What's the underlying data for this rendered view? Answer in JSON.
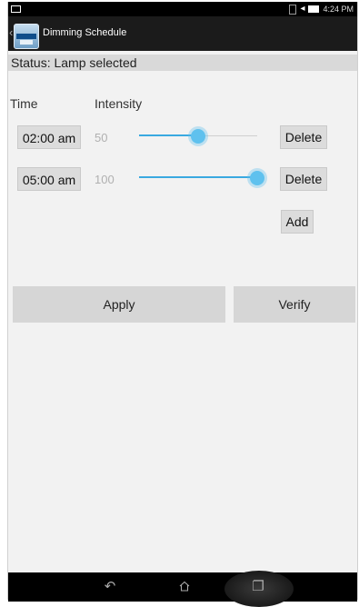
{
  "status_bar": {
    "time": "4:24 PM",
    "icons": [
      "notification-icon",
      "sim-icon",
      "wifi-icon",
      "battery-icon"
    ]
  },
  "action_bar": {
    "title": "Dimming Schedule",
    "app_icon": "lamp-app-icon"
  },
  "status_line": "Status: Lamp selected",
  "table": {
    "columns": [
      "Time",
      "Intensity"
    ],
    "rows": [
      {
        "time": "02:00 am",
        "intensity": "50",
        "level": 0.5,
        "delete_label": "Delete"
      },
      {
        "time": "05:00 am",
        "intensity": "100",
        "level": 1.0,
        "delete_label": "Delete"
      }
    ],
    "add_label": "Add"
  },
  "actions": {
    "apply_label": "Apply",
    "verify_label": "Verify"
  },
  "nav": {
    "icons": [
      "back-icon",
      "home-icon",
      "recent-apps-icon"
    ]
  },
  "colors": {
    "accent": "#39a9e0",
    "status_bar": "#000000",
    "action_bar": "#1b1b1b"
  }
}
